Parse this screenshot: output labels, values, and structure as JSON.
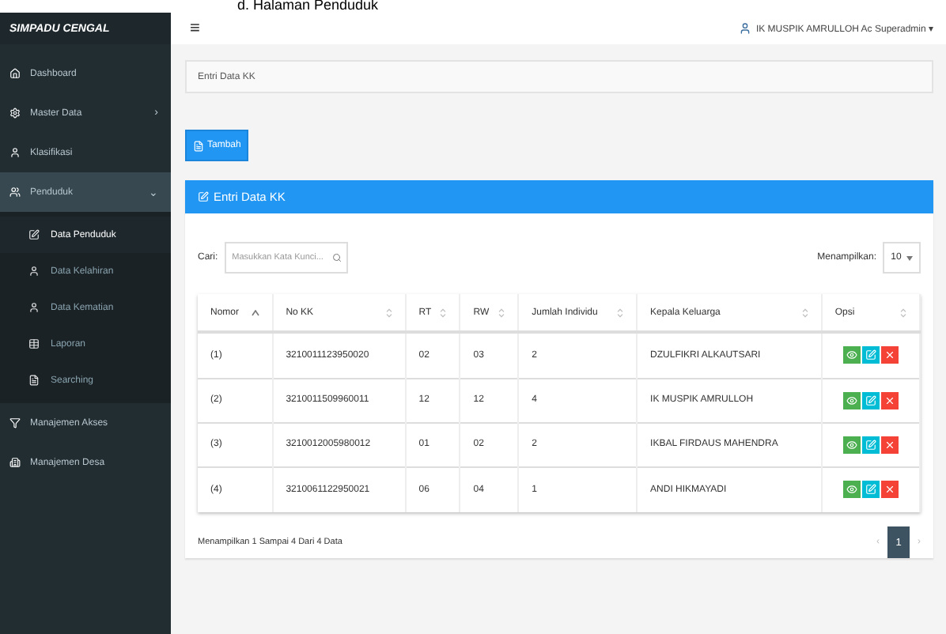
{
  "caption": "d.   Halaman Penduduk",
  "brand": "SIMPADU CENGAL",
  "header": {
    "menu_glyph": "≡",
    "user": "IK MUSPIK AMRULLOH Ac Superadmin",
    "caret": "▾"
  },
  "sidebar": {
    "items": [
      {
        "label": "Dashboard",
        "selected": false
      },
      {
        "label": "Master Data",
        "arrow": "›",
        "selected": false
      },
      {
        "label": "Klasifikasi",
        "selected": false
      },
      {
        "label": "Penduduk",
        "arrow": "⌄",
        "expanded": true,
        "selected": true,
        "children": [
          {
            "label": "Data Penduduk",
            "selected": true
          },
          {
            "label": "Data Kelahiran",
            "selected": false
          },
          {
            "label": "Data Kematian",
            "selected": false
          },
          {
            "label": "Laporan",
            "selected": false
          },
          {
            "label": "Searching",
            "selected": false
          }
        ]
      },
      {
        "label": "Manajemen Akses",
        "selected": false
      },
      {
        "label": "Manajemen Desa",
        "selected": false
      }
    ]
  },
  "breadcrumb": "Entri Data KK",
  "add_button": "Tambah",
  "card": {
    "title": "Entri Data KK",
    "search": {
      "label": "Cari:",
      "placeholder": "Masukkan Kata Kunci..."
    },
    "page_size": {
      "label": "Menampilkan:",
      "value": "10"
    },
    "table": {
      "columns": [
        {
          "label": "Nomor",
          "sorted": true
        },
        {
          "label": "No KK",
          "sorted": false
        },
        {
          "label": "RT",
          "sorted": false
        },
        {
          "label": "RW",
          "sorted": false
        },
        {
          "label": "Jumlah Individu",
          "sorted": false
        },
        {
          "label": "Kepala Keluarga",
          "sorted": false
        },
        {
          "label": "Opsi",
          "sorted": false
        }
      ],
      "rows": [
        {
          "cells": [
            "(1)",
            "3210011123950020",
            "02",
            "03",
            "2",
            "DZULFIKRI ALKAUTSARI"
          ]
        },
        {
          "cells": [
            "(2)",
            "3210011509960011",
            "12",
            "12",
            "4",
            "IK MUSPIK AMRULLOH"
          ]
        },
        {
          "cells": [
            "(3)",
            "3210012005980012",
            "01",
            "02",
            "2",
            "IKBAL FIRDAUS MAHENDRA"
          ]
        },
        {
          "cells": [
            "(4)",
            "3210061122950021",
            "06",
            "04",
            "1",
            "ANDI HIKMAYADI"
          ]
        }
      ]
    },
    "footer": "Menampilkan 1 Sampai 4 Dari 4 Data",
    "pagination": {
      "prev": "‹",
      "pages": [
        {
          "label": "1",
          "selected": true
        }
      ],
      "next": "›"
    }
  }
}
